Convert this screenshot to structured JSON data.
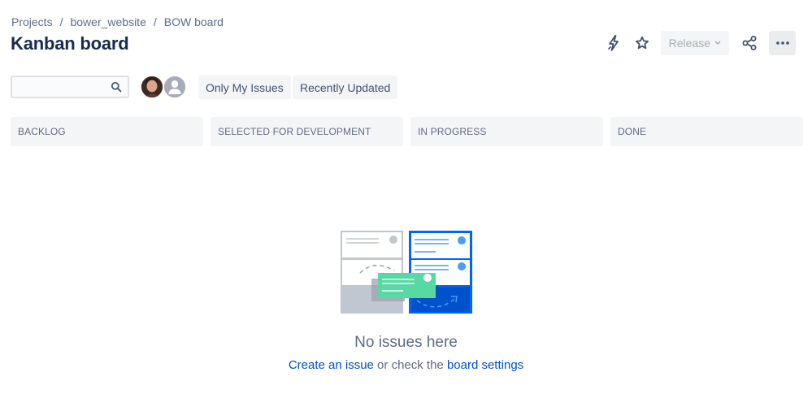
{
  "breadcrumb": {
    "items": [
      "Projects",
      "bower_website",
      "BOW board"
    ],
    "separator": "/"
  },
  "page_title": "Kanban board",
  "header_actions": {
    "lightning_icon": "lightning-icon",
    "star_icon": "star-icon",
    "release_label": "Release",
    "share_icon": "share-icon",
    "more_icon": "more-icon"
  },
  "filters": {
    "search_value": "",
    "only_my_issues": "Only My Issues",
    "recently_updated": "Recently Updated"
  },
  "columns": [
    "BACKLOG",
    "SELECTED FOR DEVELOPMENT",
    "IN PROGRESS",
    "DONE"
  ],
  "empty_state": {
    "title": "No issues here",
    "create_link": "Create an issue",
    "middle_text": " or check the ",
    "settings_link": "board settings"
  },
  "colors": {
    "primary_text": "#172b4d",
    "secondary_text": "#5e6c84",
    "link": "#0052cc",
    "illustration_blue": "#0065ff",
    "illustration_green": "#57d9a3",
    "column_bg": "#f4f5f7"
  }
}
